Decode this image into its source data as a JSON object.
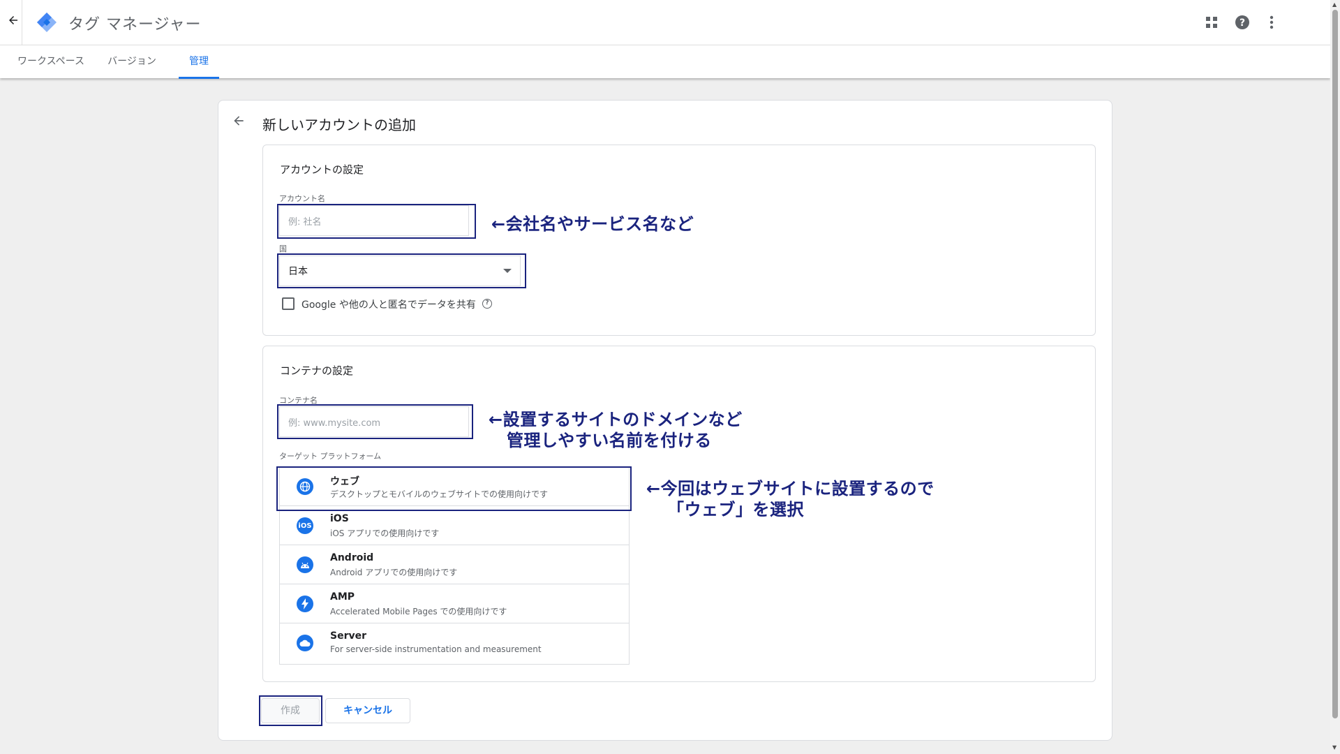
{
  "header": {
    "app_title": "タグ マネージャー",
    "back_icon": "arrow-back-icon",
    "icons": [
      "apps-grid-icon",
      "help-icon",
      "more-vert-icon"
    ]
  },
  "tabs": [
    {
      "label": "ワークスペース",
      "active": false
    },
    {
      "label": "バージョン",
      "active": false
    },
    {
      "label": "管理",
      "active": true
    }
  ],
  "page": {
    "title": "新しいアカウントの追加"
  },
  "account_section": {
    "title": "アカウントの設定",
    "account_name_label": "アカウント名",
    "account_name_placeholder": "例: 社名",
    "country_label": "国",
    "country_value": "日本",
    "share_checkbox_label": "Google や他の人と匿名でデータを共有",
    "share_checked": false
  },
  "container_section": {
    "title": "コンテナの設定",
    "container_name_label": "コンテナ名",
    "container_name_placeholder": "例: www.mysite.com",
    "platform_label": "ターゲット プラットフォーム",
    "platforms": [
      {
        "name": "ウェブ",
        "desc": "デスクトップとモバイルのウェブサイトでの使用向けです",
        "icon": "globe-icon",
        "selected": true
      },
      {
        "name": "iOS",
        "desc": "iOS アプリでの使用向けです",
        "icon": "ios-icon",
        "selected": false
      },
      {
        "name": "Android",
        "desc": "Android アプリでの使用向けです",
        "icon": "android-icon",
        "selected": false
      },
      {
        "name": "AMP",
        "desc": "Accelerated Mobile Pages での使用向けです",
        "icon": "amp-bolt-icon",
        "selected": false
      },
      {
        "name": "Server",
        "desc": "For server-side instrumentation and measurement",
        "icon": "cloud-icon",
        "selected": false
      }
    ]
  },
  "actions": {
    "create_label": "作成",
    "cancel_label": "キャンセル"
  },
  "annotations": {
    "account_name": "←会社名やサービス名など",
    "container_line1": "←設置するサイトのドメインなど",
    "container_line2": "管理しやすい名前を付ける",
    "web_line1": "←今回はウェブサイトに設置するので",
    "web_line2": "「ウェブ」を選択"
  },
  "colors": {
    "accent": "#1a73e8",
    "annotation": "#1a237e"
  }
}
